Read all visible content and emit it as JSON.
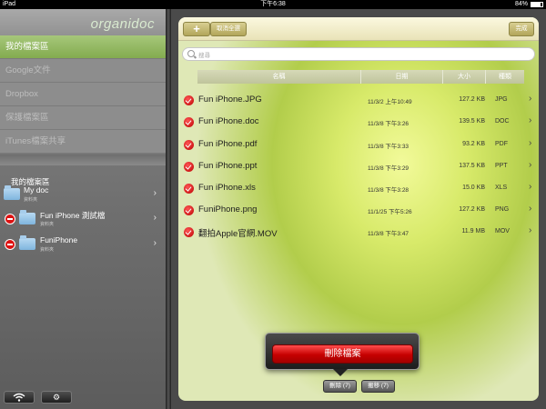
{
  "status_bar": {
    "device": "iPad",
    "time": "下午6:38",
    "battery": "84%",
    "battery_level": 0.84
  },
  "app": {
    "logo": "organidoc"
  },
  "sidebar": {
    "nav": [
      {
        "label": "我的檔案區",
        "active": true
      },
      {
        "label": "Google文件",
        "active": false
      },
      {
        "label": "Dropbox",
        "active": false
      },
      {
        "label": "保護檔案區",
        "active": false
      },
      {
        "label": "iTunes檔案共享",
        "active": false
      }
    ],
    "section_title": "我的檔案區",
    "folders": [
      {
        "name": "My doc",
        "subtitle": "資料夾",
        "delete": false
      },
      {
        "name": "Fun iPhone 測試檔",
        "subtitle": "資料夾",
        "delete": true
      },
      {
        "name": "FuniPhone",
        "subtitle": "資料夾",
        "delete": true
      }
    ]
  },
  "toolbar": {
    "add_label": "+",
    "select_all_label": "取消全選",
    "done_label": "完成"
  },
  "search": {
    "placeholder": "搜尋"
  },
  "table": {
    "headers": {
      "name": "名稱",
      "date": "日期",
      "size": "大小",
      "type": "種類"
    },
    "rows": [
      {
        "name": "Fun iPhone.JPG",
        "date": "11/3/2 上午10:49",
        "size": "127.2 KB",
        "type": "JPG"
      },
      {
        "name": "Fun iPhone.doc",
        "date": "11/3/8 下午3:26",
        "size": "139.5 KB",
        "type": "DOC"
      },
      {
        "name": "Fun iPhone.pdf",
        "date": "11/3/8 下午3:33",
        "size": "93.2 KB",
        "type": "PDF"
      },
      {
        "name": "Fun iPhone.ppt",
        "date": "11/3/8 下午3:29",
        "size": "137.5 KB",
        "type": "PPT"
      },
      {
        "name": "Fun iPhone.xls",
        "date": "11/3/8 下午3:28",
        "size": "15.0 KB",
        "type": "XLS"
      },
      {
        "name": "FuniPhone.png",
        "date": "11/1/25 下午5:26",
        "size": "127.2 KB",
        "type": "PNG"
      },
      {
        "name": "翻拍Apple官網.MOV",
        "date": "11/3/8 下午3:47",
        "size": "11.9 MB",
        "type": "MOV"
      }
    ]
  },
  "popover": {
    "delete_files_label": "刪除檔案"
  },
  "bottom_bar": {
    "delete_label": "刪除 (7)",
    "move_label": "搬移 (7)"
  },
  "colors": {
    "accent_green": "#8db35a",
    "delete_red": "#d40000",
    "panel_green": "#d8ea6a"
  }
}
